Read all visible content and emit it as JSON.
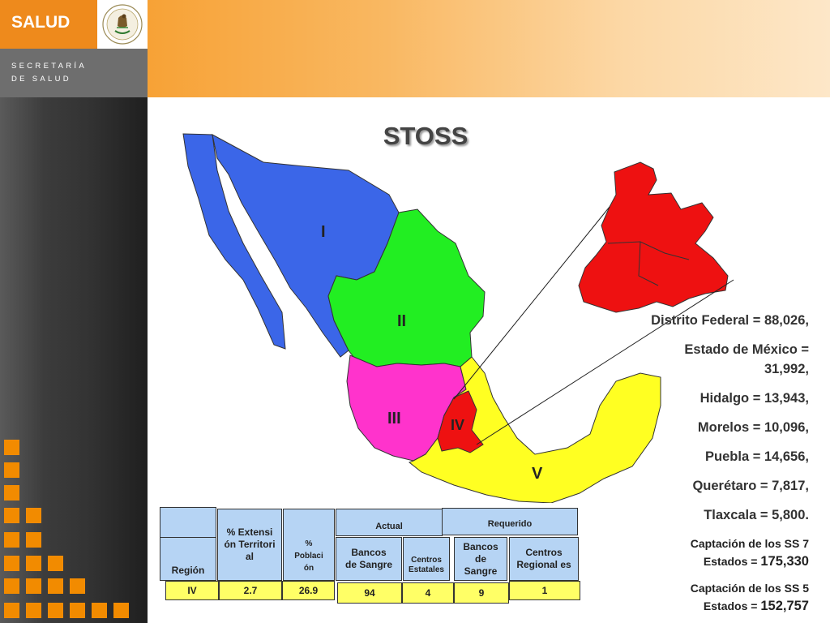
{
  "header": {
    "brand": "SALUD",
    "subtitle_line1": "SECRETARÍA",
    "subtitle_line2": "DE SALUD"
  },
  "title": "STOSS",
  "map": {
    "regions": [
      {
        "label": "I",
        "color": "#3b66e8"
      },
      {
        "label": "II",
        "color": "#22ee22"
      },
      {
        "label": "III",
        "color": "#ff33cc"
      },
      {
        "label": "IV",
        "color": "#ee1111"
      },
      {
        "label": "V",
        "color": "#ffff22"
      }
    ]
  },
  "stats": [
    "Distrito Federal = 88,026,",
    "Estado de México =",
    "31,992,",
    "Hidalgo = 13,943,",
    "Morelos = 10,096,",
    "Puebla = 14,656,",
    "Querétaro = 7,817,",
    "Tlaxcala = 5,800."
  ],
  "captacion": [
    {
      "line1": "Captación de los SS 7",
      "line2": "Estados =",
      "value": "175,330"
    },
    {
      "line1": "Captación de los SS 5",
      "line2": "Estados =",
      "value": "152,757"
    }
  ],
  "table": {
    "headers": {
      "region": "Región",
      "extension": "% Extensi ón Territori al",
      "poblacion": "% Poblaci ón",
      "actual": "Actual",
      "requerido": "Requerido",
      "bancos_actual": "Bancos de Sangre",
      "centros_estatales": "Centros Estatales",
      "bancos_requerido": "Bancos de Sangre",
      "centros_regionales": "Centros Regional es"
    },
    "row": {
      "region": "IV",
      "extension": "2.7",
      "poblacion": "26.9",
      "bancos_actual": "94",
      "centros_estatales": "4",
      "bancos_requerido": "9",
      "centros_regionales": "1"
    }
  }
}
